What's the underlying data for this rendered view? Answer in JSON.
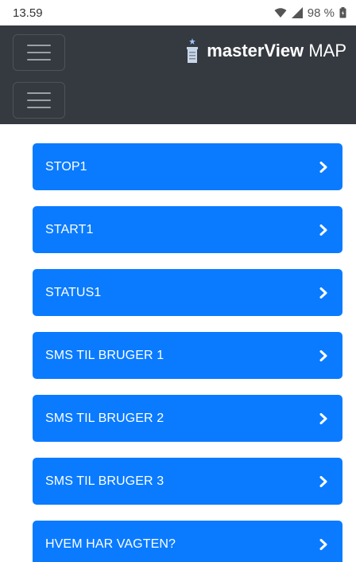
{
  "status_bar": {
    "time": "13.59",
    "battery": "98 %",
    "icons": [
      "wifi-icon",
      "signal-icon",
      "battery-icon"
    ]
  },
  "header": {
    "brand_bold": "masterView",
    "brand_light": "MAP",
    "logo_icon": "tower-icon",
    "menu_icon": "hamburger-icon"
  },
  "items": [
    {
      "label": "STOP1"
    },
    {
      "label": "START1"
    },
    {
      "label": "STATUS1"
    },
    {
      "label": "SMS TIL BRUGER 1"
    },
    {
      "label": "SMS TIL BRUGER 2"
    },
    {
      "label": "SMS TIL BRUGER 3"
    },
    {
      "label": "HVEM HAR VAGTEN?"
    }
  ],
  "colors": {
    "header_bg": "#343a40",
    "button_bg": "#0a7bff",
    "text_light": "#ffffff"
  }
}
